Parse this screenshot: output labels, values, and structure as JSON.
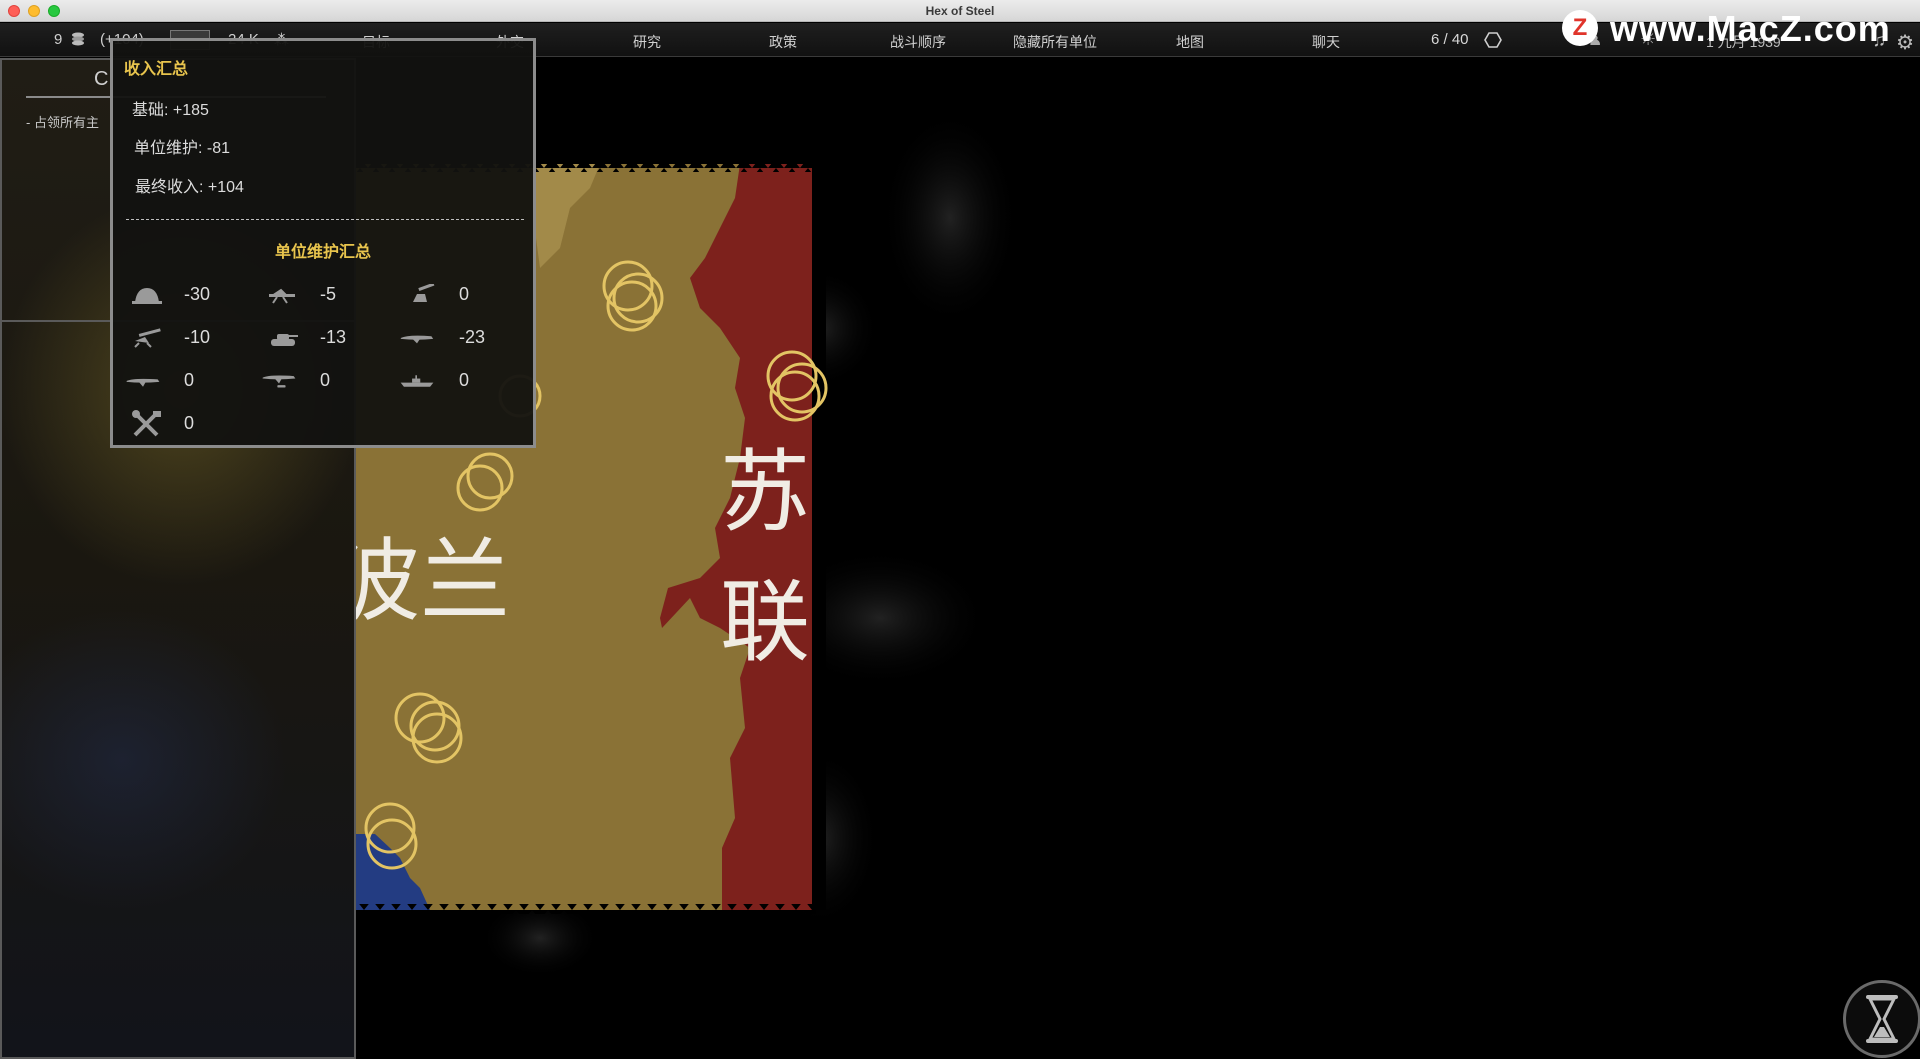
{
  "window": {
    "title": "Hex of Steel"
  },
  "topbar": {
    "resources": {
      "gold": "9",
      "gold_delta": "(+104)",
      "manpower": "24 K"
    },
    "menu": [
      "目标",
      "外交",
      "研究",
      "政策",
      "战斗顺序",
      "隐藏所有单位",
      "地图",
      "聊天"
    ],
    "turn": "6 / 40",
    "date": "1 九月 1939"
  },
  "watermark": {
    "logo": "Z",
    "text": "www.MacZ.com"
  },
  "left_panel": {
    "tab_label": "C",
    "objective": "- 占领所有主"
  },
  "map": {
    "labels": [
      "波兰",
      "苏联"
    ]
  },
  "tooltip": {
    "title": "收入汇总",
    "base": "基础: +185",
    "upkeep": "单位维护: -81",
    "final": "最终收入: +104",
    "upkeep_title": "单位维护汇总",
    "upkeep_items": [
      {
        "icon": "infantry-helmet-icon",
        "value": "-30"
      },
      {
        "icon": "anti-tank-gun-icon",
        "value": "-5"
      },
      {
        "icon": "anti-air-gun-icon",
        "value": "0"
      },
      {
        "icon": "artillery-icon",
        "value": "-10"
      },
      {
        "icon": "tank-icon",
        "value": "-13"
      },
      {
        "icon": "fighter-plane-icon",
        "value": "-23"
      },
      {
        "icon": "bomber-plane-icon",
        "value": "0"
      },
      {
        "icon": "dive-bomber-icon",
        "value": "0"
      },
      {
        "icon": "ship-icon",
        "value": "0"
      },
      {
        "icon": "repair-tools-icon",
        "value": "0"
      }
    ]
  },
  "colors": {
    "poland_territory": "#8a7236",
    "poland_territory_light": "#a8904f",
    "soviet_territory": "#7d211c",
    "allied_territory": "#233c82",
    "tooltip_accent": "#e8c44d",
    "city_rings": "#e3c464"
  }
}
